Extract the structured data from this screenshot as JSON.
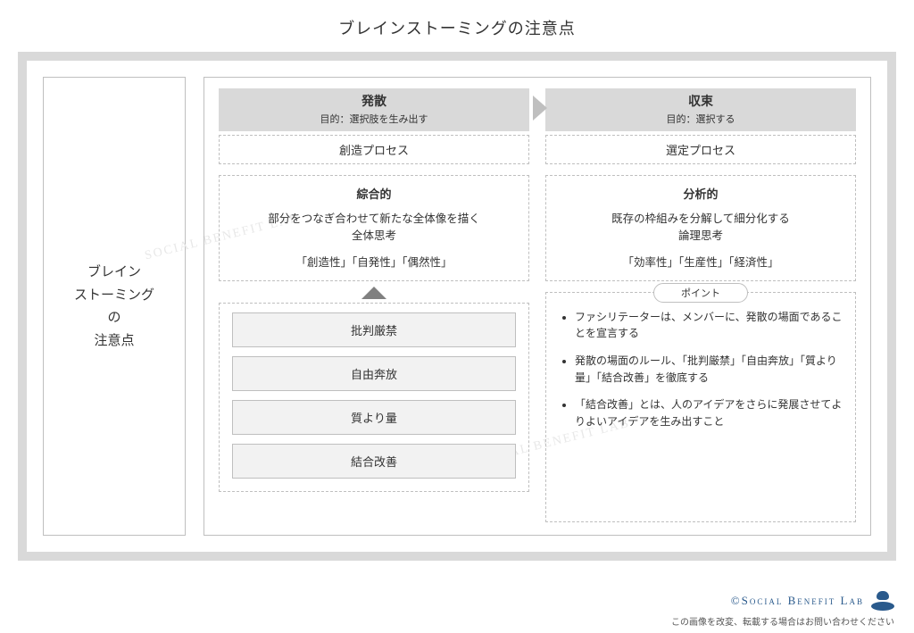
{
  "title": "ブレインストーミングの注意点",
  "sidebar": {
    "label": "ブレイン\nストーミング\nの\n注意点"
  },
  "phases": {
    "diverge": {
      "name": "発散",
      "objective": "目的：選択肢を生み出す",
      "process": "創造プロセス",
      "thinking_name": "綜合的",
      "thinking_desc": "部分をつなぎ合わせて新たな全体像を描く\n全体思考",
      "thinking_keys": "「創造性」「自発性」「偶然性」"
    },
    "converge": {
      "name": "収束",
      "objective": "目的：選択する",
      "process": "選定プロセス",
      "thinking_name": "分析的",
      "thinking_desc": "既存の枠組みを分解して細分化する\n論理思考",
      "thinking_keys": "「効率性」「生産性」「経済性」"
    }
  },
  "rules": [
    "批判厳禁",
    "自由奔放",
    "質より量",
    "結合改善"
  ],
  "points": {
    "label": "ポイント",
    "items": [
      "ファシリテーターは、メンバーに、発散の場面であることを宣言する",
      "発散の場面のルール、「批判厳禁」「自由奔放」「質より量」「結合改善」を徹底する",
      "「結合改善」とは、人のアイデアをさらに発展させてよりよいアイデアを生み出すこと"
    ]
  },
  "watermark": "SOCIAL BENEFIT LAB",
  "footer": {
    "brand": "©Social Benefit Lab",
    "note": "この画像を改変、転載する場合はお問い合わせください"
  }
}
